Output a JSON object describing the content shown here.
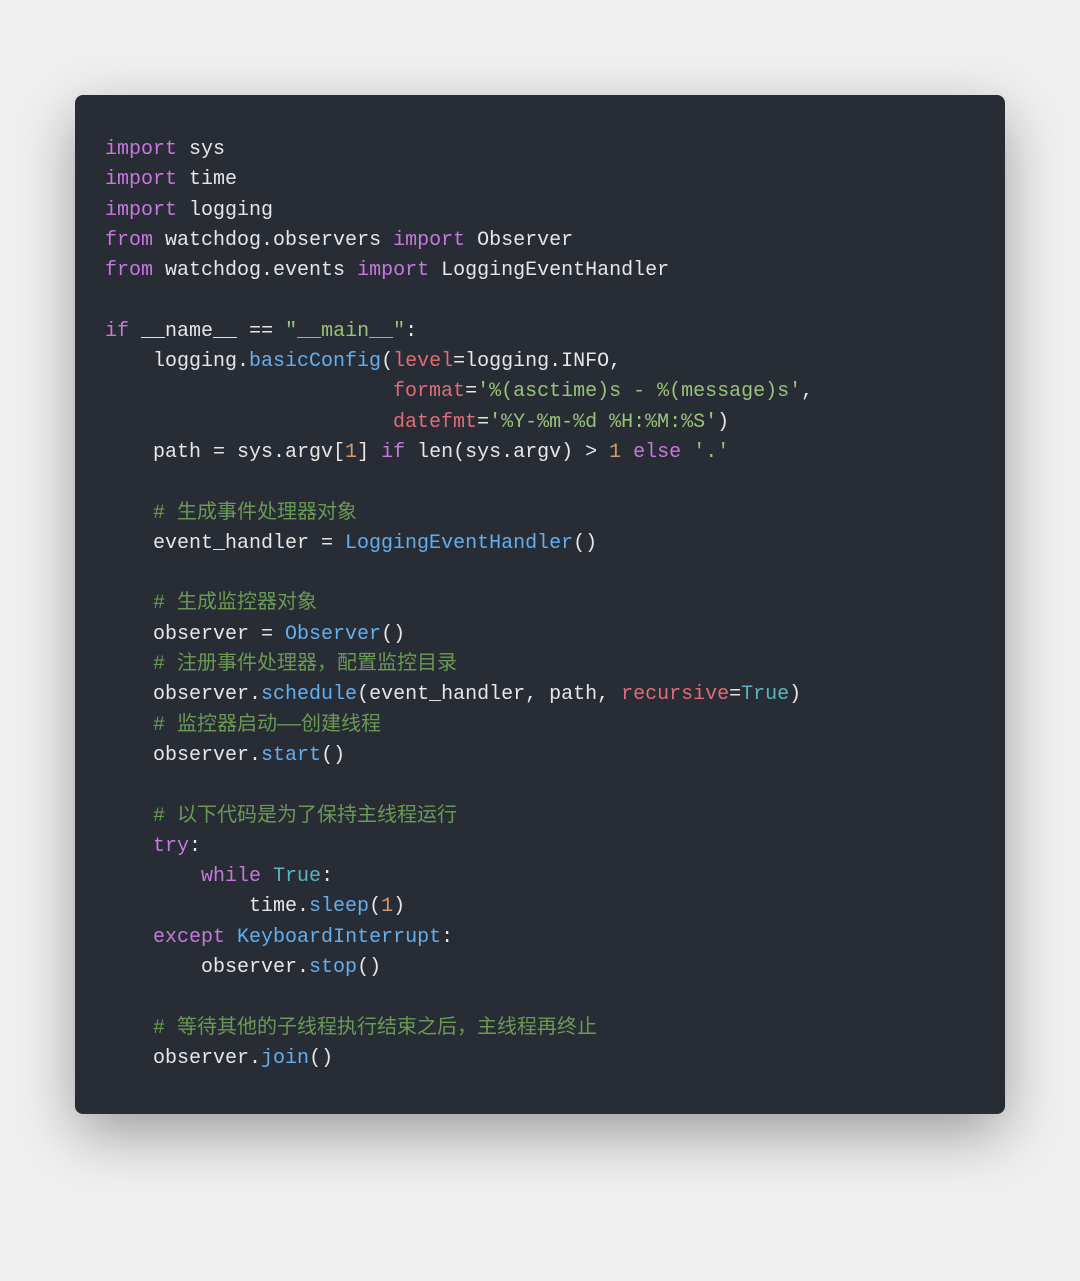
{
  "code": {
    "l1": {
      "kw": "import",
      "mod": "sys"
    },
    "l2": {
      "kw": "import",
      "mod": "time"
    },
    "l3": {
      "kw": "import",
      "mod": "logging"
    },
    "l4": {
      "kw1": "from",
      "mod": "watchdog.observers",
      "kw2": "import",
      "cls": "Observer"
    },
    "l5": {
      "kw1": "from",
      "mod": "watchdog.events",
      "kw2": "import",
      "cls": "LoggingEventHandler"
    },
    "l6": {
      "kw": "if",
      "dunder": "__name__",
      "eq": "==",
      "str": "\"__main__\"",
      "colon": ":"
    },
    "l7": {
      "indent": "    ",
      "obj": "logging.",
      "fn": "basicConfig",
      "open": "(",
      "param": "level",
      "eqs": "=logging.INFO,"
    },
    "l8": {
      "indent": "                        ",
      "param": "format",
      "eq": "=",
      "str": "'%(asctime)s - %(message)s'",
      "comma": ","
    },
    "l9": {
      "indent": "                        ",
      "param": "datefmt",
      "eq": "=",
      "str": "'%Y-%m-%d %H:%M:%S'",
      "close": ")"
    },
    "l10": {
      "indent": "    ",
      "path": "path = sys.argv[",
      "num": "1",
      "mid": "] ",
      "kw1": "if",
      "txt": " len(sys.argv) > ",
      "num2": "1",
      "sp": " ",
      "kw2": "else",
      "sp2": " ",
      "str": "'.'"
    },
    "l11": {
      "indent": "    ",
      "comment": "# 生成事件处理器对象"
    },
    "l12": {
      "indent": "    ",
      "txt": "event_handler = ",
      "fn": "LoggingEventHandler",
      "paren": "()"
    },
    "l13": {
      "indent": "    ",
      "comment": "# 生成监控器对象"
    },
    "l14": {
      "indent": "    ",
      "txt": "observer = ",
      "fn": "Observer",
      "paren": "()"
    },
    "l15": {
      "indent": "    ",
      "comment": "# 注册事件处理器，配置监控目录"
    },
    "l16": {
      "indent": "    ",
      "txt": "observer.",
      "fn": "schedule",
      "open": "(event_handler, path, ",
      "param": "recursive",
      "eq": "=",
      "const": "True",
      "close": ")"
    },
    "l17": {
      "indent": "    ",
      "comment": "# 监控器启动——创建线程"
    },
    "l18": {
      "indent": "    ",
      "txt": "observer.",
      "fn": "start",
      "paren": "()"
    },
    "l19": {
      "indent": "    ",
      "comment": "# 以下代码是为了保持主线程运行"
    },
    "l20": {
      "indent": "    ",
      "kw": "try",
      "colon": ":"
    },
    "l21": {
      "indent": "        ",
      "kw": "while",
      "sp": " ",
      "const": "True",
      "colon": ":"
    },
    "l22": {
      "indent": "            ",
      "txt": "time.",
      "fn": "sleep",
      "open": "(",
      "num": "1",
      "close": ")"
    },
    "l23": {
      "indent": "    ",
      "kw": "except",
      "sp": " ",
      "exc": "KeyboardInterrupt",
      "colon": ":"
    },
    "l24": {
      "indent": "        ",
      "txt": "observer.",
      "fn": "stop",
      "paren": "()"
    },
    "l25": {
      "indent": "    ",
      "comment": "# 等待其他的子线程执行结束之后，主线程再终止"
    },
    "l26": {
      "indent": "    ",
      "txt": "observer.",
      "fn": "join",
      "paren": "()"
    }
  }
}
